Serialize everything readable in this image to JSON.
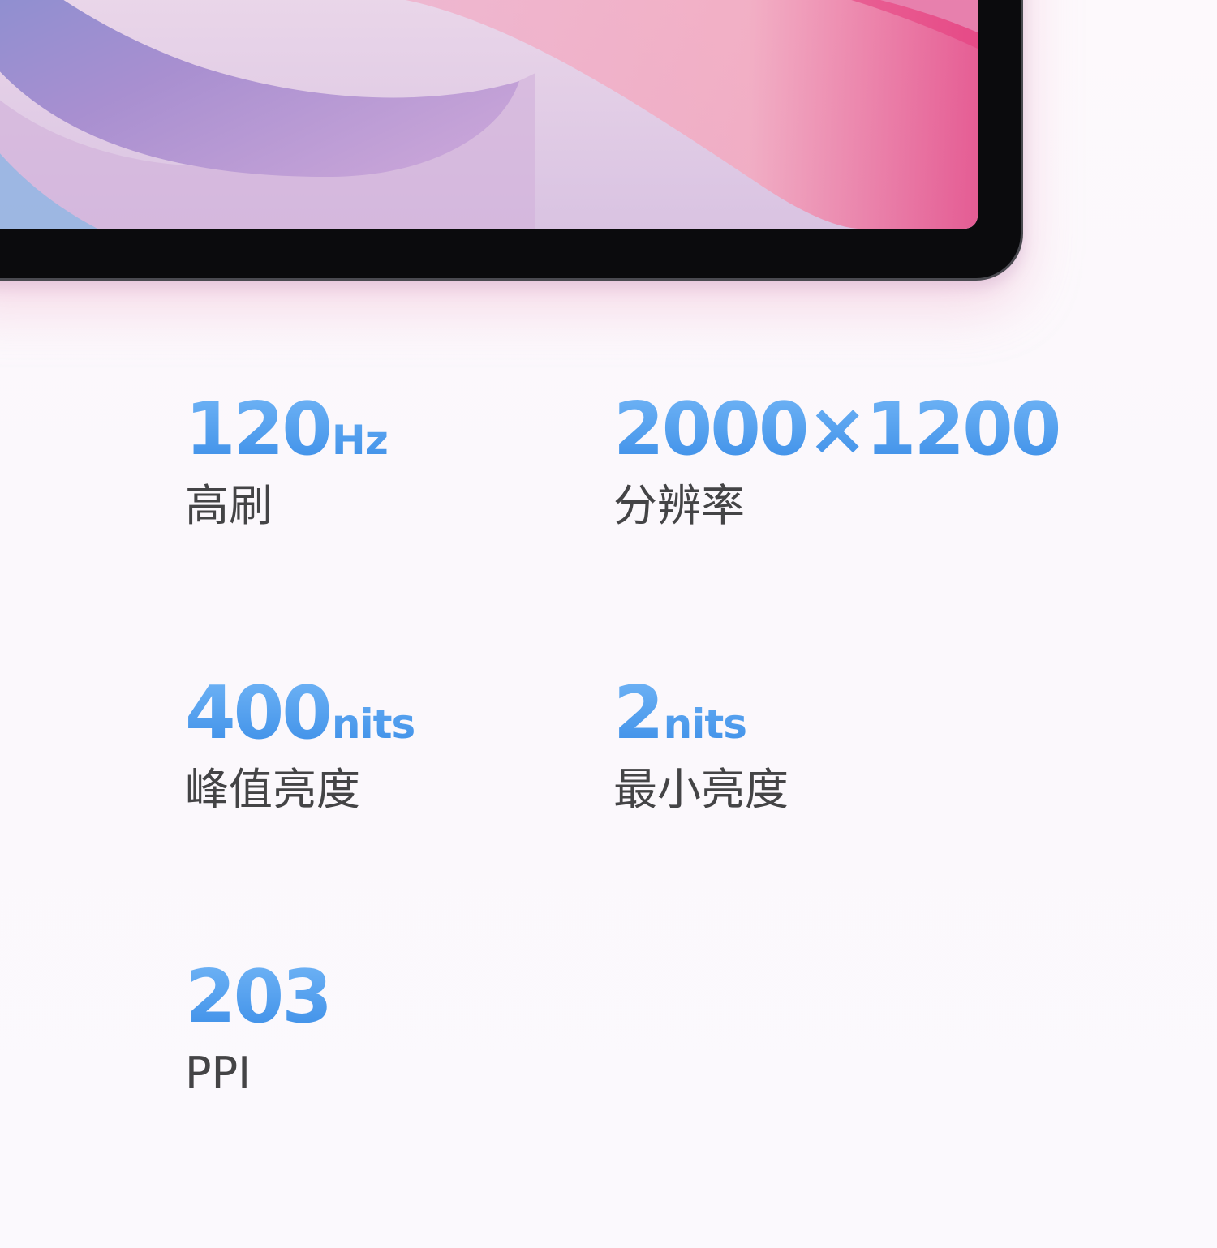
{
  "specs": [
    {
      "value": "120",
      "unit": "Hz",
      "label": "高刷"
    },
    {
      "value": "2000×1200",
      "unit": "",
      "label": "分辨率"
    },
    {
      "value": "400",
      "unit": "nits",
      "label": "峰值亮度"
    },
    {
      "value": "2",
      "unit": "nits",
      "label": "最小亮度"
    },
    {
      "value": "203",
      "unit": "",
      "label": "PPI"
    }
  ],
  "colors": {
    "value_gradient_top": "#6fb3f5",
    "value_gradient_bottom": "#3d8fe8",
    "label": "#444446",
    "background": "#fbf8fc"
  }
}
